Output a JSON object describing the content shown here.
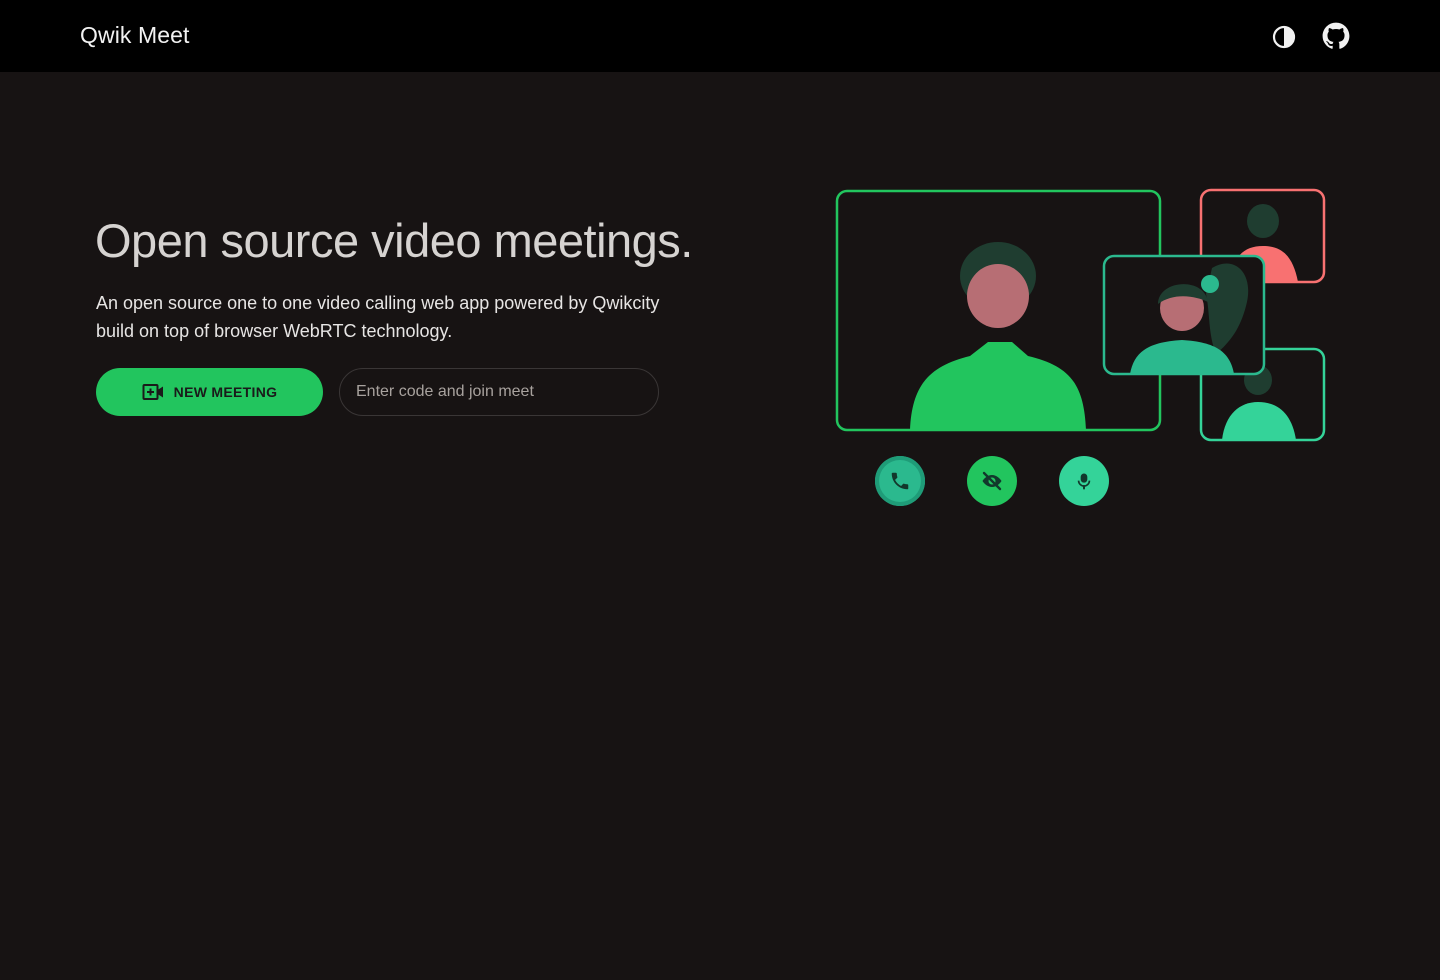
{
  "header": {
    "brand": "Qwik Meet",
    "theme_toggle_icon": "contrast-icon",
    "github_icon": "github-icon"
  },
  "hero": {
    "title": "Open source video meetings.",
    "description": "An open source one to one video calling web app powered by Qwikcity build on top of browser WebRTC technology.",
    "new_meeting_label": "NEW MEETING",
    "new_meeting_icon": "video-plus-icon",
    "join_placeholder": "Enter code and join meet"
  },
  "illustration": {
    "controls": [
      "phone-icon",
      "eye-off-icon",
      "microphone-icon"
    ],
    "colors": {
      "primary": "#22c55e",
      "teal": "#34d399",
      "coral": "#f87171",
      "dark_hair": "#1f3d30",
      "skin": "#b76e74"
    }
  },
  "colors": {
    "background": "#171313",
    "header": "#000000",
    "accent": "#22c55e"
  }
}
